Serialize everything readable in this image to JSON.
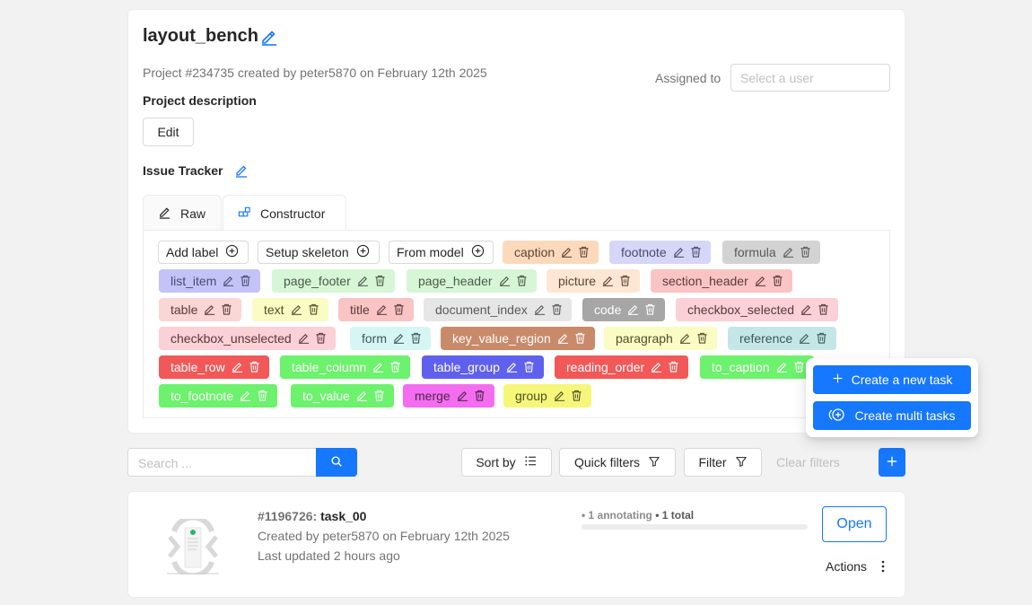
{
  "project": {
    "title": "layout_bench",
    "meta": "Project #234735 created by peter5870 on February 12th 2025",
    "assigned_label": "Assigned to",
    "assigned_placeholder": "Select a user",
    "description_label": "Project description",
    "edit_label": "Edit",
    "issue_tracker_label": "Issue Tracker"
  },
  "tabs": [
    {
      "label": "Raw",
      "icon": "pencil-icon"
    },
    {
      "label": "Constructor",
      "icon": "blocks-icon",
      "active": true
    }
  ],
  "constructor_buttons": [
    "Add label",
    "Setup skeleton",
    "From model"
  ],
  "labels": [
    {
      "name": "caption",
      "bg": "#fdd9bb",
      "fg": "#5a4636"
    },
    {
      "name": "footnote",
      "bg": "#d6d6f8",
      "fg": "#4a4a70"
    },
    {
      "name": "formula",
      "bg": "#d3d3d3",
      "fg": "#595959"
    },
    {
      "name": "list_item",
      "bg": "#c3c3f8",
      "fg": "#4a4a70"
    },
    {
      "name": "page_footer",
      "bg": "#d6f6d6",
      "fg": "#4a5a4a"
    },
    {
      "name": "page_header",
      "bg": "#d6f6d6",
      "fg": "#4a5a4a"
    },
    {
      "name": "picture",
      "bg": "#fde6d3",
      "fg": "#5a4636"
    },
    {
      "name": "section_header",
      "bg": "#fbc4c4",
      "fg": "#5a3a3a"
    },
    {
      "name": "table",
      "bg": "#fbd6d6",
      "fg": "#5a3a3a"
    },
    {
      "name": "text",
      "bg": "#fbfbc4",
      "fg": "#4f4f2a"
    },
    {
      "name": "title",
      "bg": "#fbc4c4",
      "fg": "#5a3a3a"
    },
    {
      "name": "document_index",
      "bg": "#e6e6e6",
      "fg": "#595959"
    },
    {
      "name": "code",
      "bg": "#a6a6a6",
      "fg": "#ffffff"
    },
    {
      "name": "checkbox_selected",
      "bg": "#fbd0d6",
      "fg": "#5a3a3a"
    },
    {
      "name": "checkbox_unselected",
      "bg": "#fbd0d6",
      "fg": "#5a3a3a"
    },
    {
      "name": "form",
      "bg": "#d6f6f6",
      "fg": "#3a5a5a"
    },
    {
      "name": "key_value_region",
      "bg": "#c98a6a",
      "fg": "#ffffff"
    },
    {
      "name": "paragraph",
      "bg": "#fbfbc4",
      "fg": "#4f4f2a"
    },
    {
      "name": "reference",
      "bg": "#c4e6e6",
      "fg": "#3a5a5a"
    },
    {
      "name": "table_row",
      "bg": "#f25858",
      "fg": "#ffffff"
    },
    {
      "name": "table_column",
      "bg": "#6cf26c",
      "fg": "#ffffff"
    },
    {
      "name": "table_group",
      "bg": "#6060ee",
      "fg": "#ffffff"
    },
    {
      "name": "reading_order",
      "bg": "#f25858",
      "fg": "#ffffff"
    },
    {
      "name": "to_caption",
      "bg": "#6cf26c",
      "fg": "#ffffff"
    },
    {
      "name": "to_footnote",
      "bg": "#6cf26c",
      "fg": "#ffffff"
    },
    {
      "name": "to_value",
      "bg": "#6cf26c",
      "fg": "#ffffff"
    },
    {
      "name": "merge",
      "bg": "#f46cf0",
      "fg": "#4a2a4a"
    },
    {
      "name": "group",
      "bg": "#f6f67a",
      "fg": "#4f4f2a"
    }
  ],
  "toolbar": {
    "search_placeholder": "Search ...",
    "sort_label": "Sort by",
    "quick_filters_label": "Quick filters",
    "filter_label": "Filter",
    "clear_filters_label": "Clear filters"
  },
  "popover": {
    "create_task_label": "Create a new task",
    "create_multi_label": "Create multi tasks"
  },
  "task": {
    "id": "#1196726:",
    "name": "task_00",
    "created": "Created by peter5870 on February 12th 2025",
    "updated": "Last updated 2 hours ago",
    "status_prefix": "• 1 annotating",
    "status_total": "• 1 total",
    "progress": 0,
    "open_label": "Open",
    "actions_label": "Actions"
  },
  "colors": {
    "accent": "#1677ff"
  }
}
